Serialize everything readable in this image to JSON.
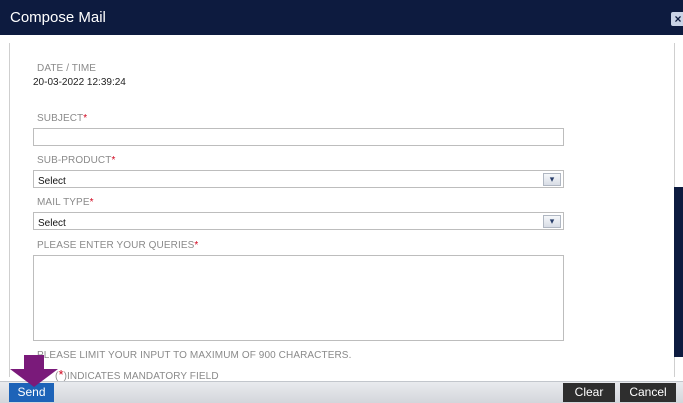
{
  "window": {
    "title": "Compose Mail",
    "close_glyph": "×"
  },
  "form": {
    "datetime_label": "DATE / TIME",
    "datetime_value": "20-03-2022 12:39:24",
    "subject_label": "SUBJECT",
    "subject_value": "",
    "subproduct_label": "SUB-PRODUCT",
    "subproduct_selected": "Select",
    "mailtype_label": "MAIL TYPE",
    "mailtype_selected": "Select",
    "queries_label": "PLEASE ENTER YOUR QUERIES",
    "queries_value": "",
    "required_mark": "*",
    "limit_note": "PLEASE LIMIT YOUR INPUT TO MAXIMUM OF 900 CHARACTERS.",
    "mandatory_open": "(",
    "mandatory_close": ")INDICATES MANDATORY FIELD",
    "dropdown_glyph": "▾"
  },
  "footer": {
    "send": "Send",
    "clear": "Clear",
    "cancel": "Cancel"
  },
  "colors": {
    "titlebar": "#0d1b3f",
    "send": "#1d63b8",
    "dark_button": "#2e2e2e",
    "required": "#d0021b",
    "arrow": "#7a1a7a"
  }
}
